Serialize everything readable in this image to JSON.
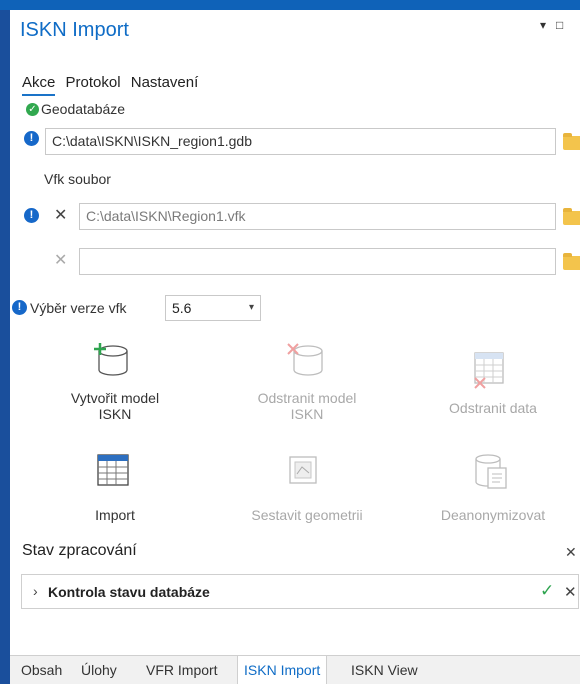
{
  "panel": {
    "title": "ISKN Import",
    "controls": {
      "pin": "▾",
      "maximize": "□"
    }
  },
  "tabs": [
    "Akce",
    "Protokol",
    "Nastavení"
  ],
  "geodatabase": {
    "label": "Geodatabáze",
    "value": "C:\\data\\ISKN\\ISKN_region1.gdb"
  },
  "vfk": {
    "label": "Vfk soubor",
    "file1": "C:\\data\\ISKN\\Region1.vfk",
    "file2": ""
  },
  "version": {
    "label": "Výběr verze vfk",
    "value": "5.6"
  },
  "actions": [
    {
      "line1": "Vytvořit model",
      "line2": "ISKN",
      "icon": "create-db-icon",
      "enabled": true
    },
    {
      "line1": "Odstranit model",
      "line2": "ISKN",
      "icon": "delete-db-icon",
      "enabled": false
    },
    {
      "line1": "Odstranit data",
      "line2": "",
      "icon": "delete-data-icon",
      "enabled": false
    },
    {
      "line1": "Import",
      "line2": "",
      "icon": "import-table-icon",
      "enabled": true
    },
    {
      "line1": "Sestavit geometrii",
      "line2": "",
      "icon": "geometry-icon",
      "enabled": false
    },
    {
      "line1": "Deanonymizovat",
      "line2": "",
      "icon": "deanonymize-icon",
      "enabled": false
    }
  ],
  "status": {
    "title": "Stav zpracování",
    "row": "Kontrola stavu databáze"
  },
  "bottom_tabs": [
    "Obsah",
    "Úlohy",
    "VFR Import",
    "ISKN Import",
    "ISKN View"
  ],
  "colors": {
    "accent": "#0f6cc6",
    "ok": "#31a84f",
    "warn": "#1668c9",
    "folder": "#f3c44c"
  }
}
